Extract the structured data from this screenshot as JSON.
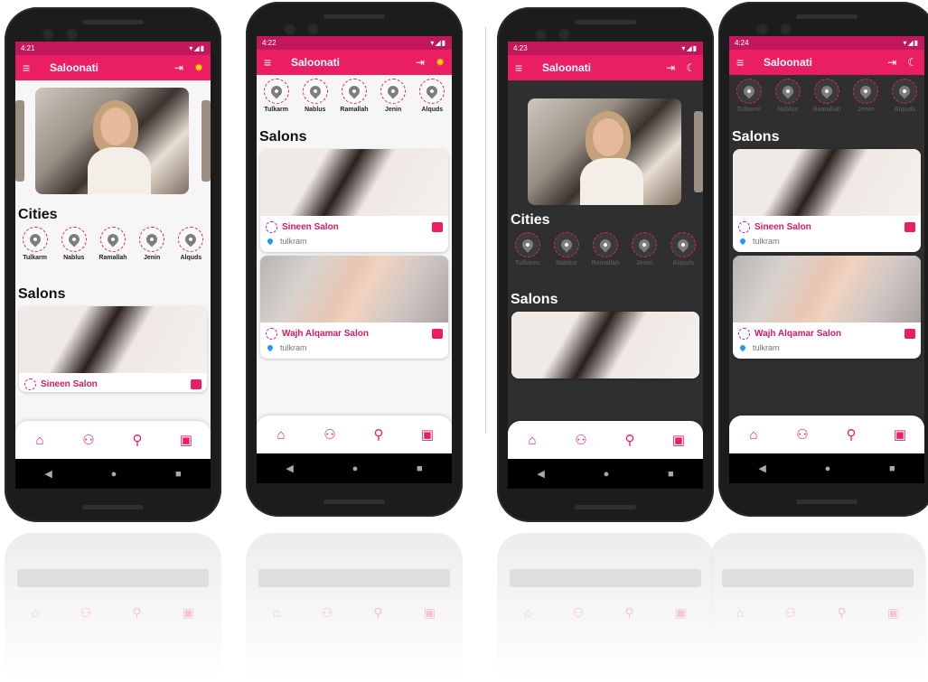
{
  "colors": {
    "primary": "#e91e63",
    "statusbar": "#c2185b",
    "accent": "#ffd600",
    "location": "#2196f3"
  },
  "icons": {
    "menu": "menu-icon",
    "logout": "logout-icon",
    "theme_light": "sun-icon",
    "theme_dark": "moon-icon",
    "home": "home-icon",
    "profile": "person-icon",
    "search": "search-icon",
    "bag": "shopping-bag-icon",
    "chat": "chat-icon",
    "pin": "location-pin-icon"
  },
  "phones": [
    {
      "time": "4:21",
      "title": "Saloonati",
      "cities_title": "Cities",
      "salons_title": "Salons",
      "cities": [
        "Tulkarm",
        "Nablus",
        "Ramallah",
        "Jenin",
        "Alquds"
      ],
      "salons": [
        {
          "name": "Sineen Salon",
          "location": ""
        }
      ]
    },
    {
      "time": "4:22",
      "title": "Saloonati",
      "cities_title": "",
      "salons_title": "Salons",
      "cities": [
        "Tulkarm",
        "Nablus",
        "Ramallah",
        "Jenin",
        "Alquds"
      ],
      "salons": [
        {
          "name": "Sineen Salon",
          "location": "tulkram"
        },
        {
          "name": "Wajh Alqamar Salon",
          "location": "tulkram"
        }
      ]
    },
    {
      "time": "4:23",
      "title": "Saloonati",
      "cities_title": "Cities",
      "salons_title": "Salons",
      "cities": [
        "Tulkarm",
        "Nablus",
        "Ramallah",
        "Jenin",
        "Alquds"
      ],
      "salons": []
    },
    {
      "time": "4:24",
      "title": "Saloonati",
      "cities_title": "",
      "salons_title": "Salons",
      "cities": [
        "Tulkarm",
        "Nablus",
        "Ramallah",
        "Jenin",
        "Alquds"
      ],
      "salons": [
        {
          "name": "Sineen Salon",
          "location": "tulkram"
        },
        {
          "name": "Wajh Alqamar Salon",
          "location": "tulkram"
        }
      ]
    }
  ]
}
